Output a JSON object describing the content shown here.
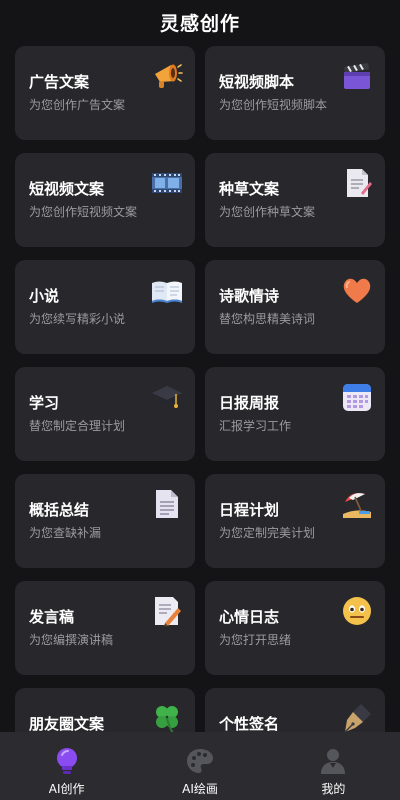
{
  "header": {
    "title": "灵感创作"
  },
  "cards": [
    {
      "title": "广告文案",
      "subtitle": "为您创作广告文案",
      "icon": "megaphone-icon"
    },
    {
      "title": "短视频脚本",
      "subtitle": "为您创作短视频脚本",
      "icon": "clapperboard-icon"
    },
    {
      "title": "短视频文案",
      "subtitle": "为您创作短视频文案",
      "icon": "film-strip-icon"
    },
    {
      "title": "种草文案",
      "subtitle": "为您创作种草文案",
      "icon": "document-pen-icon"
    },
    {
      "title": "小说",
      "subtitle": "为您续写精彩小说",
      "icon": "open-book-icon"
    },
    {
      "title": "诗歌情诗",
      "subtitle": "替您构思精美诗词",
      "icon": "heart-icon"
    },
    {
      "title": "学习",
      "subtitle": "替您制定合理计划",
      "icon": "graduation-cap-icon"
    },
    {
      "title": "日报周报",
      "subtitle": "汇报学习工作",
      "icon": "calendar-icon"
    },
    {
      "title": "概括总结",
      "subtitle": "为您查缺补漏",
      "icon": "document-icon"
    },
    {
      "title": "日程计划",
      "subtitle": "为您定制完美计划",
      "icon": "beach-umbrella-icon"
    },
    {
      "title": "发言稿",
      "subtitle": "为您编撰演讲稿",
      "icon": "memo-pencil-icon"
    },
    {
      "title": "心情日志",
      "subtitle": "为您打开思绪",
      "icon": "face-icon"
    },
    {
      "title": "朋友圈文案",
      "subtitle": "",
      "icon": "clover-icon"
    },
    {
      "title": "个性签名",
      "subtitle": "",
      "icon": "fountain-pen-icon"
    }
  ],
  "tabbar": {
    "tabs": [
      {
        "label": "AI创作",
        "icon": "bulb-icon",
        "active": true
      },
      {
        "label": "AI绘画",
        "icon": "palette-icon",
        "active": false
      },
      {
        "label": "我的",
        "icon": "user-icon",
        "active": false
      }
    ]
  },
  "colors": {
    "background": "#141416",
    "card": "#28282c",
    "tabbar": "#2c2c30",
    "accent": "#8a4cf0"
  }
}
